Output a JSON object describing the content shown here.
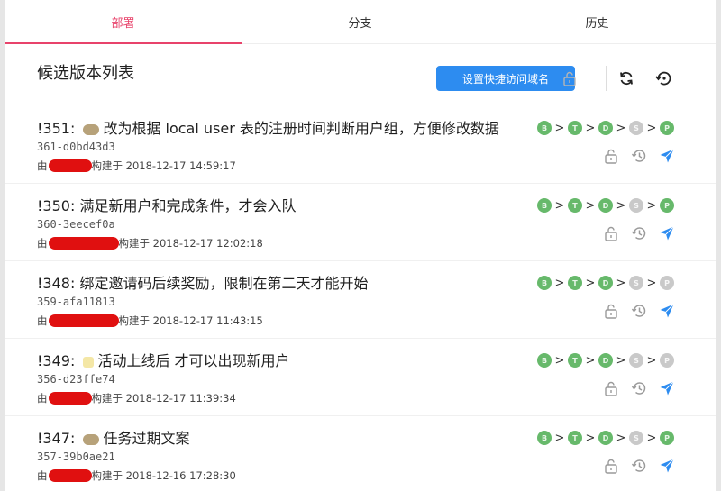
{
  "tabs": [
    {
      "label": "部署",
      "active": true
    },
    {
      "label": "分支",
      "active": false
    },
    {
      "label": "历史",
      "active": false
    }
  ],
  "header": {
    "title": "候选版本列表",
    "alias_button": "设置快捷访问域名"
  },
  "colors": {
    "accent": "#e8436b",
    "primary": "#2d8cf0",
    "stage_done": "#67b96b",
    "stage_pending": "#c9c9c9",
    "send": "#2d8cf0"
  },
  "rows": [
    {
      "title": "!351:  改为根据 local user 表的注册时间判断用户组，方便修改数据",
      "prefix": "!351:",
      "text": "改为根据 local user 表的注册时间判断用户组，方便修改数据",
      "emoji": "bean",
      "hash": "361-d0bd43d3",
      "by": "由",
      "built": "构建于 2018-12-17 14:59:17",
      "stages": [
        "B",
        "T",
        "D",
        "S",
        "P"
      ],
      "stage_states": [
        "done",
        "done",
        "done",
        "pending",
        "done"
      ]
    },
    {
      "prefix": "!350:",
      "text": "满足新用户和完成条件，才会入队",
      "emoji": "",
      "hash": "360-3eecef0a",
      "by": "由",
      "built": "构建于 2018-12-17 12:02:18",
      "stages": [
        "B",
        "T",
        "D",
        "S",
        "P"
      ],
      "stage_states": [
        "done",
        "done",
        "done",
        "pending",
        "done"
      ]
    },
    {
      "prefix": "!348:",
      "text": "绑定邀请码后续奖励，限制在第二天才能开始",
      "emoji": "",
      "hash": "359-afa11813",
      "by": "由",
      "built": "构建于 2018-12-17 11:43:15",
      "stages": [
        "B",
        "T",
        "D",
        "S",
        "P"
      ],
      "stage_states": [
        "done",
        "done",
        "done",
        "pending",
        "pending"
      ]
    },
    {
      "prefix": "!349:",
      "text": "活动上线后 才可以出现新用户",
      "emoji": "sparkle",
      "hash": "356-d23ffe74",
      "by": "由",
      "built": "构建于 2018-12-17 11:39:34",
      "stages": [
        "B",
        "T",
        "D",
        "S",
        "P"
      ],
      "stage_states": [
        "done",
        "done",
        "done",
        "pending",
        "pending"
      ]
    },
    {
      "prefix": "!347:",
      "text": "任务过期文案",
      "emoji": "bean",
      "hash": "357-39b0ae21",
      "by": "由",
      "built": "构建于 2018-12-16 17:28:30",
      "stages": [
        "B",
        "T",
        "D",
        "S",
        "P"
      ],
      "stage_states": [
        "done",
        "done",
        "done",
        "pending",
        "done"
      ]
    }
  ],
  "redact_widths": [
    48,
    78,
    78,
    48,
    48
  ],
  "icons": {
    "lock": "lock-open-icon",
    "history": "history-icon",
    "send": "send-icon",
    "refresh": "refresh-icon",
    "restore": "restore-icon"
  }
}
